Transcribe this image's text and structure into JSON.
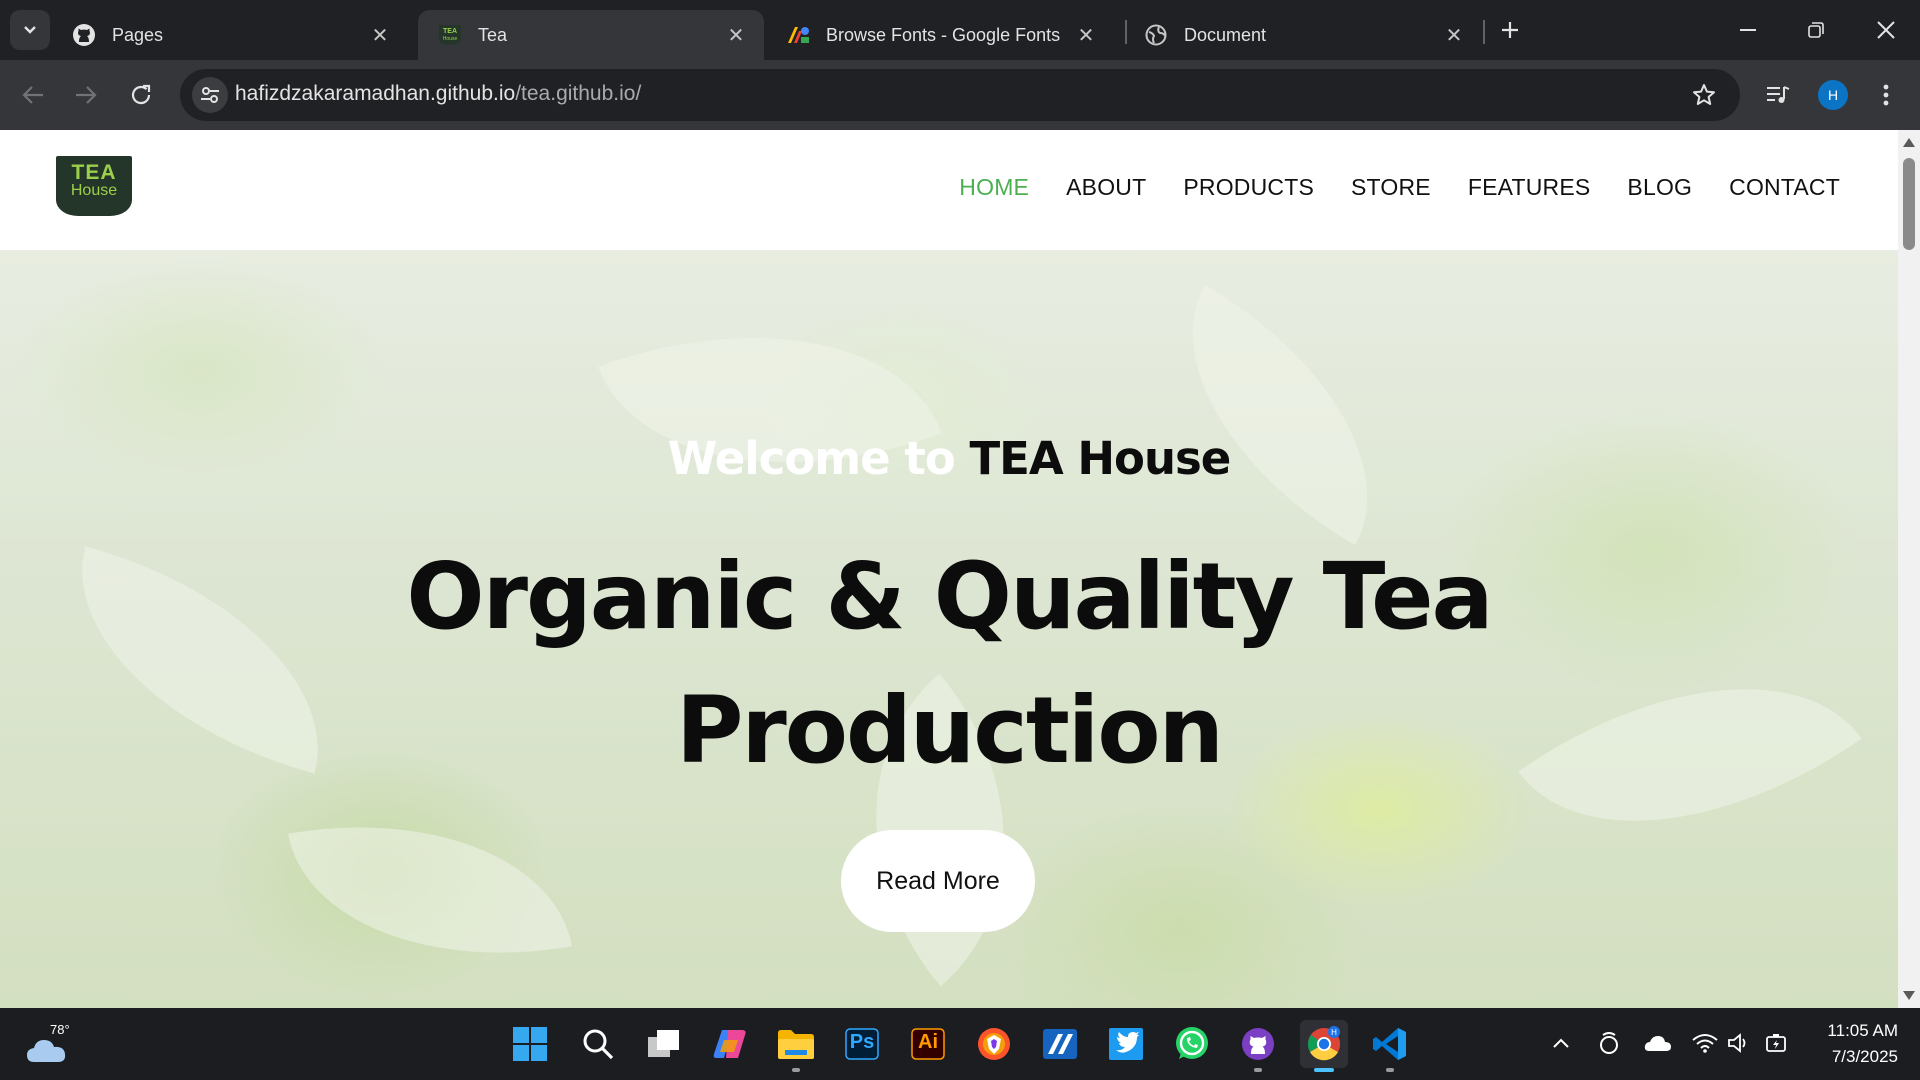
{
  "browser": {
    "tabs": [
      {
        "title": "Pages",
        "icon": "github-icon",
        "active": false
      },
      {
        "title": "Tea",
        "icon": "tea-house-favicon",
        "active": true
      },
      {
        "title": "Browse Fonts - Google Fonts",
        "icon": "google-fonts-icon",
        "active": false
      },
      {
        "title": "Document",
        "icon": "globe-icon",
        "active": false
      }
    ],
    "url_host": "hafizdzakaramadhan.github.io",
    "url_path": "/tea.github.io/",
    "profile_initial": "H"
  },
  "site": {
    "logo_line1": "TEA",
    "logo_line2": "House",
    "nav": [
      "HOME",
      "ABOUT",
      "PRODUCTS",
      "STORE",
      "FEATURES",
      "BLOG",
      "CONTACT"
    ],
    "nav_active": "HOME",
    "hero": {
      "welcome_prefix": "Welcome to",
      "welcome_brand": "TEA House",
      "headline_line1": "Organic & Quality Tea",
      "headline_line2": "Production",
      "cta": "Read More"
    },
    "colors": {
      "accent": "#4caf50",
      "logo_bg": "#24352a",
      "logo_text": "#9ad04a"
    }
  },
  "taskbar": {
    "weather_temp": "78°",
    "apps": [
      "start-icon",
      "search-icon",
      "task-view-icon",
      "copilot-icon",
      "file-explorer-icon",
      "photoshop-icon",
      "illustrator-icon",
      "brave-icon",
      "app-icon",
      "twitter-icon",
      "whatsapp-icon",
      "github-desktop-icon",
      "chrome-icon",
      "vscode-icon"
    ],
    "photoshop_label": "Ps",
    "illustrator_label": "Ai",
    "time": "11:05 AM",
    "date": "7/3/2025"
  }
}
